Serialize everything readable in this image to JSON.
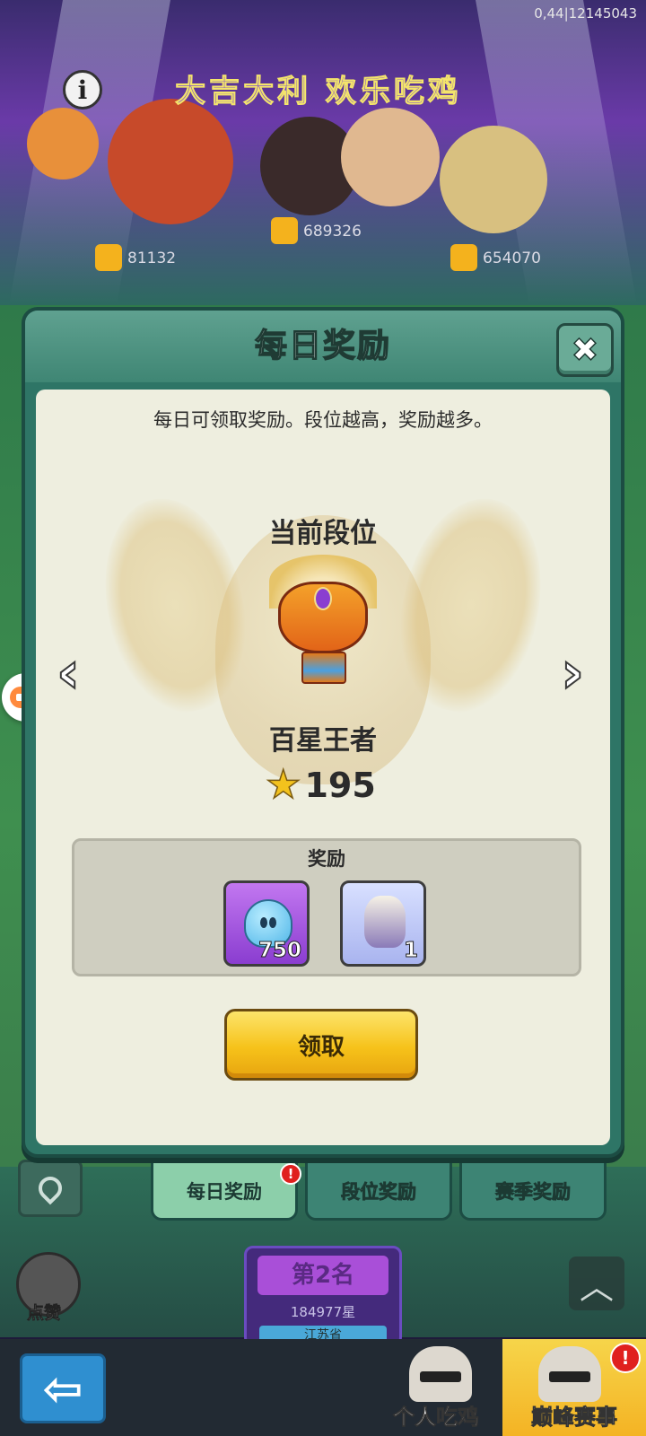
{
  "status": {
    "version": "0,44|12145043"
  },
  "banner": {
    "title": "大吉大利 欢乐吃鸡",
    "like_counts": [
      "81132",
      "689326",
      "654070"
    ]
  },
  "dialog": {
    "title": "每日奖励",
    "description": "每日可领取奖励。段位越高，奖励越多。",
    "current_rank_label": "当前段位",
    "rank_name": "百星王者",
    "stars": "195",
    "rewards_label": "奖励",
    "rewards": [
      {
        "icon": "soul-ghost-icon",
        "qty": "750"
      },
      {
        "icon": "figurine-icon",
        "qty": "1"
      }
    ],
    "claim_label": "领取"
  },
  "tabs": [
    {
      "label": "每日奖励",
      "active": true,
      "badge": "!"
    },
    {
      "label": "段位奖励",
      "active": false
    },
    {
      "label": "赛季奖励",
      "active": false
    }
  ],
  "side": {
    "like_label": "点赞"
  },
  "rank_card": {
    "place": "第2名",
    "stars": "184977星",
    "region": "江苏省"
  },
  "bottom_nav": {
    "items": [
      {
        "label": "个人吃鸡",
        "active": false
      },
      {
        "label": "巅峰赛事",
        "active": true,
        "badge": "!"
      }
    ]
  },
  "colors": {
    "accent": "#3d8474",
    "claim": "#f6c21a",
    "badge": "#e0201e"
  }
}
